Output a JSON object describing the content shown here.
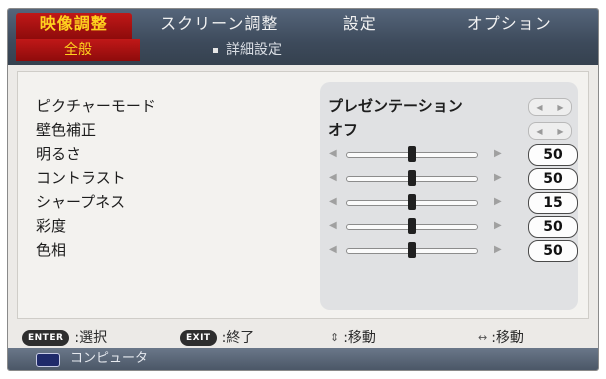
{
  "tabs": [
    "映像調整",
    "スクリーン調整",
    "設定",
    "オプション"
  ],
  "subtabs": {
    "basic": "全般",
    "detail": "詳細設定"
  },
  "rows": [
    {
      "label": "ピクチャーモード",
      "type": "select",
      "value": "プレゼンテーション"
    },
    {
      "label": "壁色補正",
      "type": "select",
      "value": "オフ"
    },
    {
      "label": "明るさ",
      "type": "slider",
      "value": "50",
      "level": 0.5
    },
    {
      "label": "コントラスト",
      "type": "slider",
      "value": "50",
      "level": 0.5
    },
    {
      "label": "シャープネス",
      "type": "slider",
      "value": "15",
      "level": 0.5
    },
    {
      "label": "彩度",
      "type": "slider",
      "value": "50",
      "level": 0.5
    },
    {
      "label": "色相",
      "type": "slider",
      "value": "50",
      "level": 0.5
    }
  ],
  "footer": {
    "enter_key": "ENTER",
    "enter_label": ":選択",
    "exit_key": "EXIT",
    "exit_label": ":終了",
    "updown_symbol": "⇕",
    "updown_label": ":移動",
    "leftright_symbol": "↔",
    "leftright_label": ":移動"
  },
  "status": {
    "source_icon": "monitor-icon",
    "source_label": "コンピュータ"
  },
  "colors": {
    "accent_tab": "#a81313",
    "accent_text": "#ffd21e",
    "menubar": "#3d4a5b"
  }
}
